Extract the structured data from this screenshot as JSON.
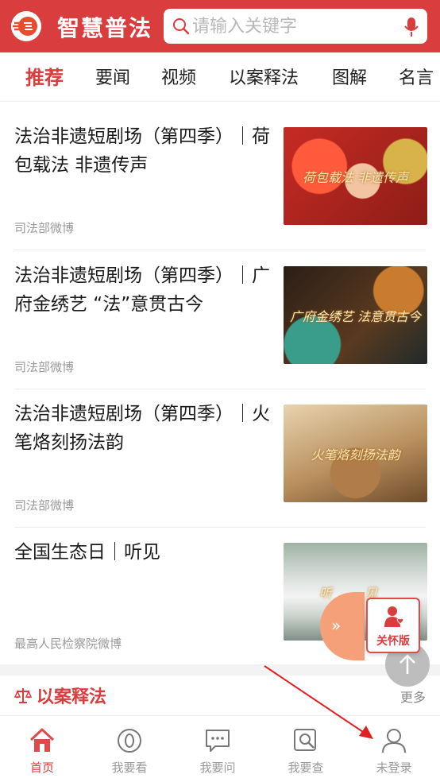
{
  "header": {
    "title": "智慧普法",
    "search_placeholder": "请输入关键字"
  },
  "tabs": [
    {
      "label": "推荐",
      "active": true
    },
    {
      "label": "要闻"
    },
    {
      "label": "视频"
    },
    {
      "label": "以案释法"
    },
    {
      "label": "图解"
    },
    {
      "label": "名言"
    }
  ],
  "feed": [
    {
      "title": "法治非遗短剧场（第四季）｜荷包载法 非遗传声",
      "source": "司法部微博",
      "thumb_text": "荷包载法 非遗传声"
    },
    {
      "title": "法治非遗短剧场（第四季）｜广府金绣艺 “法”意贯古今",
      "source": "司法部微博",
      "thumb_text": "广府金绣艺 法意贯古今"
    },
    {
      "title": "法治非遗短剧场（第四季）｜火笔烙刻扬法韵",
      "source": "司法部微博",
      "thumb_text": "火笔烙刻扬法韵"
    },
    {
      "title": "全国生态日｜听见",
      "source": "最高人民检察院微博",
      "thumb_text": "听 见"
    }
  ],
  "section": {
    "title": "以案释法",
    "more": "更多"
  },
  "care_mode": {
    "label": "关怀版"
  },
  "float_tab": {
    "arrows": "»"
  },
  "bottom_nav": [
    {
      "label": "首页",
      "icon": "home-icon",
      "active": true
    },
    {
      "label": "我要看",
      "icon": "eye-icon"
    },
    {
      "label": "我要问",
      "icon": "chat-icon"
    },
    {
      "label": "我要查",
      "icon": "search-doc-icon"
    },
    {
      "label": "未登录",
      "icon": "user-icon"
    }
  ],
  "colors": {
    "brand": "#d93d3d",
    "muted": "#999999",
    "float": "#f6a07a"
  }
}
